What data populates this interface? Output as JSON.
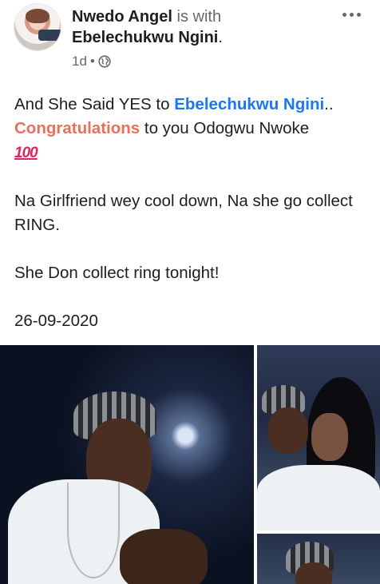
{
  "post": {
    "author": "Nwedo Angel",
    "with_text": "is with",
    "tagged": "Ebelechukwu Ngini",
    "tag_end": ".",
    "time": "1d",
    "sep": "•",
    "privacy_icon": "globe-icon",
    "menu_icon": "more-options-icon",
    "lines": {
      "l1_prefix": "And She Said YES to ",
      "l1_link": "Ebelechukwu Ngini",
      "l1_suffix": "..",
      "l2_highlight": "Congratulations",
      "l2_rest": " to you Odogwu Nwoke",
      "l3_emoji": "100",
      "p2": "Na Girlfriend wey cool down, Na she go collect RING.",
      "p3": "She Don collect ring tonight!",
      "p4": "26-09-2020"
    }
  },
  "colors": {
    "link": "#1877f2",
    "highlight": "#e9715b",
    "secondary": "#65676b",
    "emoji": "#e0245e"
  }
}
